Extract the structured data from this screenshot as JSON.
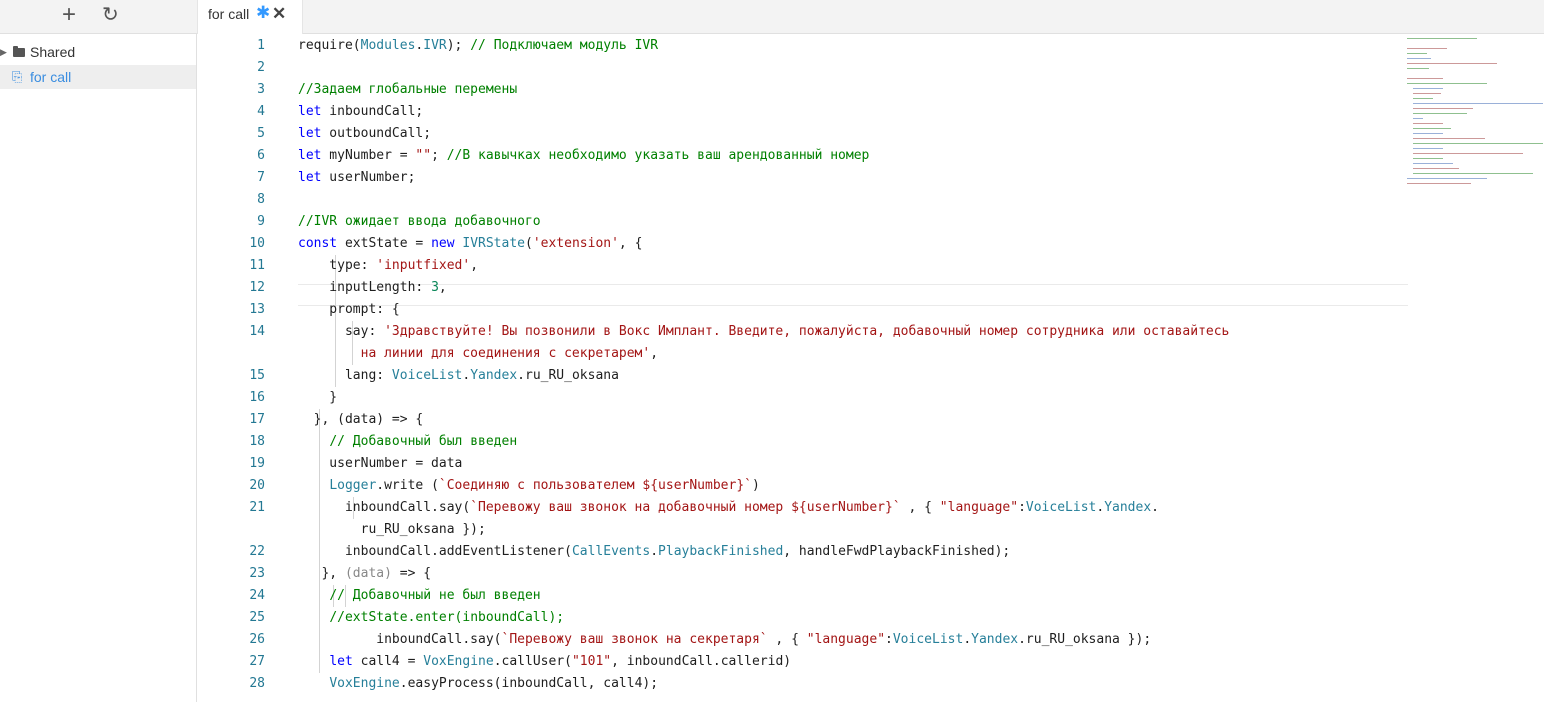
{
  "toolbar": {
    "add_icon": "+",
    "refresh_icon": "↻"
  },
  "tab": {
    "label": "for call",
    "modified_marker": "✱",
    "close_icon": "✕"
  },
  "sidebar": {
    "items": [
      {
        "label": "Shared",
        "icon": "folder-icon"
      },
      {
        "label": "for call",
        "icon": "file-icon"
      }
    ]
  },
  "editor": {
    "line_numbers": [
      "1",
      "2",
      "3",
      "4",
      "5",
      "6",
      "7",
      "8",
      "9",
      "10",
      "11",
      "12",
      "13",
      "14",
      "",
      "15",
      "16",
      "17",
      "18",
      "19",
      "20",
      "21",
      "",
      "22",
      "23",
      "24",
      "25",
      "26",
      "27",
      "28"
    ],
    "lines": [
      [
        {
          "t": "require("
        },
        {
          "t": "Modules",
          "c": "c-type"
        },
        {
          "t": "."
        },
        {
          "t": "IVR",
          "c": "c-type"
        },
        {
          "t": "); "
        },
        {
          "t": "// Подключаем модуль IVR",
          "c": "c-cm"
        }
      ],
      [],
      [
        {
          "t": "//Задаем глобальные перемены",
          "c": "c-cm"
        }
      ],
      [
        {
          "t": "let",
          "c": "c-kw"
        },
        {
          "t": " inboundCall;"
        }
      ],
      [
        {
          "t": "let",
          "c": "c-kw"
        },
        {
          "t": " outboundCall;"
        }
      ],
      [
        {
          "t": "let",
          "c": "c-kw"
        },
        {
          "t": " myNumber = "
        },
        {
          "t": "\"\"",
          "c": "c-str"
        },
        {
          "t": "; "
        },
        {
          "t": "//В кавычках необходимо указать ваш арендованный номер",
          "c": "c-cm"
        }
      ],
      [
        {
          "t": "let",
          "c": "c-kw"
        },
        {
          "t": " userNumber;"
        }
      ],
      [],
      [
        {
          "t": "//IVR ожидает ввода добавочного",
          "c": "c-cm"
        }
      ],
      [
        {
          "t": "const",
          "c": "c-kw"
        },
        {
          "t": " extState = "
        },
        {
          "t": "new",
          "c": "c-kw"
        },
        {
          "t": " "
        },
        {
          "t": "IVRState",
          "c": "c-type"
        },
        {
          "t": "("
        },
        {
          "t": "'extension'",
          "c": "c-str"
        },
        {
          "t": ", {"
        }
      ],
      [
        {
          "t": "    type: "
        },
        {
          "t": "'inputfixed'",
          "c": "c-str"
        },
        {
          "t": ","
        }
      ],
      [
        {
          "t": "    inputLength: "
        },
        {
          "t": "3",
          "c": "c-num"
        },
        {
          "t": ","
        }
      ],
      [
        {
          "t": "    prompt: {"
        }
      ],
      [
        {
          "t": "      say: "
        },
        {
          "t": "'Здравствуйте! Вы позвонили в Вокс Имплант. Введите, пожалуйста, добавочный номер сотрудника или оставайтесь",
          "c": "c-str"
        }
      ],
      [
        {
          "t": "        на линии для соединения с секретарем'",
          "c": "c-str"
        },
        {
          "t": ","
        }
      ],
      [
        {
          "t": "      lang: "
        },
        {
          "t": "VoiceList",
          "c": "c-type"
        },
        {
          "t": "."
        },
        {
          "t": "Yandex",
          "c": "c-type"
        },
        {
          "t": ".ru_RU_oksana"
        }
      ],
      [
        {
          "t": "    }"
        }
      ],
      [
        {
          "t": "  }, (data) => {"
        }
      ],
      [
        {
          "t": "    "
        },
        {
          "t": "// Добавочный был введен",
          "c": "c-cm"
        }
      ],
      [
        {
          "t": "    userNumber = data"
        }
      ],
      [
        {
          "t": "    "
        },
        {
          "t": "Logger",
          "c": "c-type"
        },
        {
          "t": ".write ("
        },
        {
          "t": "`Соединяю с пользователем ${userNumber}`",
          "c": "c-str"
        },
        {
          "t": ")"
        }
      ],
      [
        {
          "t": "      inboundCall.say("
        },
        {
          "t": "`Перевожу ваш звонок на добавочный номер ${userNumber}`",
          "c": "c-str"
        },
        {
          "t": " , { "
        },
        {
          "t": "\"language\"",
          "c": "c-str"
        },
        {
          "t": ":"
        },
        {
          "t": "VoiceList",
          "c": "c-type"
        },
        {
          "t": "."
        },
        {
          "t": "Yandex",
          "c": "c-type"
        },
        {
          "t": "."
        }
      ],
      [
        {
          "t": "        ru_RU_oksana });"
        }
      ],
      [
        {
          "t": "      inboundCall.addEventListener("
        },
        {
          "t": "CallEvents",
          "c": "c-type"
        },
        {
          "t": "."
        },
        {
          "t": "PlaybackFinished",
          "c": "c-type"
        },
        {
          "t": ", handleFwdPlaybackFinished);"
        }
      ],
      [
        {
          "t": "   }, "
        },
        {
          "t": "(data)",
          "c": "c-gray"
        },
        {
          "t": " => {"
        }
      ],
      [
        {
          "t": "    "
        },
        {
          "t": "// Добавочный не был введен",
          "c": "c-cm"
        }
      ],
      [
        {
          "t": "    "
        },
        {
          "t": "//extState.enter(inboundCall);",
          "c": "c-cm"
        }
      ],
      [
        {
          "t": "          inboundCall.say("
        },
        {
          "t": "`Перевожу ваш звонок на секретаря`",
          "c": "c-str"
        },
        {
          "t": " , { "
        },
        {
          "t": "\"language\"",
          "c": "c-str"
        },
        {
          "t": ":"
        },
        {
          "t": "VoiceList",
          "c": "c-type"
        },
        {
          "t": "."
        },
        {
          "t": "Yandex",
          "c": "c-type"
        },
        {
          "t": ".ru_RU_oksana });"
        }
      ],
      [
        {
          "t": "    "
        },
        {
          "t": "let",
          "c": "c-kw"
        },
        {
          "t": " call4 = "
        },
        {
          "t": "VoxEngine",
          "c": "c-type"
        },
        {
          "t": ".callUser("
        },
        {
          "t": "\"101\"",
          "c": "c-str"
        },
        {
          "t": ", inboundCall.callerid)"
        }
      ],
      [
        {
          "t": "    "
        },
        {
          "t": "VoxEngine",
          "c": "c-type"
        },
        {
          "t": ".easyProcess(inboundCall, call4);"
        }
      ]
    ]
  }
}
